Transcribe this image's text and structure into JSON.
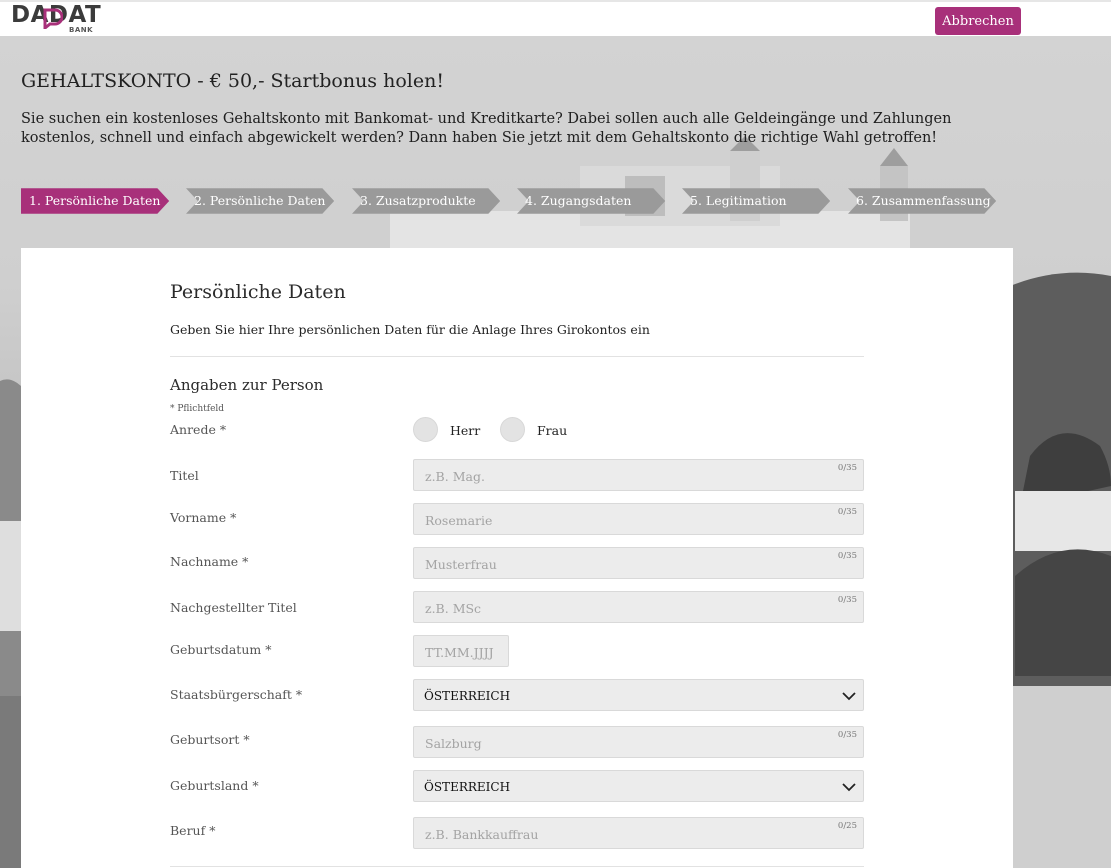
{
  "header": {
    "logo_text": "DADAT",
    "logo_sub": "BANK",
    "cancel_label": "Abbrechen"
  },
  "hero": {
    "title": "GEHALTSKONTO - € 50,- Startbonus holen!",
    "intro": "Sie suchen ein kostenloses Gehaltskonto mit Bankomat- und Kreditkarte? Dabei sollen auch alle Geldeingänge und Zahlungen kostenlos, schnell und einfach abgewickelt werden? Dann haben Sie jetzt mit dem Gehaltskonto die richtige Wahl getroffen!"
  },
  "steps": [
    {
      "label": "1. Persönliche Daten",
      "active": true
    },
    {
      "label": "2. Persönliche Daten",
      "active": false
    },
    {
      "label": "3. Zusatzprodukte",
      "active": false
    },
    {
      "label": "4. Zugangsdaten",
      "active": false
    },
    {
      "label": "5. Legitimation",
      "active": false
    },
    {
      "label": "6. Zusammenfassung",
      "active": false
    }
  ],
  "colors": {
    "accent": "#a8307a",
    "step_inactive": "#9a9a9a"
  },
  "form": {
    "section_title": "Persönliche Daten",
    "section_desc": "Geben Sie hier Ihre persönlichen Daten für die Anlage Ihres Girokontos ein",
    "sub_title": "Angaben zur Person",
    "required_note": "* Pflichtfeld",
    "anrede": {
      "label": "Anrede *",
      "options": [
        "Herr",
        "Frau"
      ]
    },
    "titel": {
      "label": "Titel",
      "placeholder": "z.B. Mag.",
      "counter": "0/35"
    },
    "vorname": {
      "label": "Vorname *",
      "placeholder": "Rosemarie",
      "counter": "0/35"
    },
    "nachname": {
      "label": "Nachname *",
      "placeholder": "Musterfrau",
      "counter": "0/35"
    },
    "nachgestellter_titel": {
      "label": "Nachgestellter Titel",
      "placeholder": "z.B. MSc",
      "counter": "0/35"
    },
    "geburtsdatum": {
      "label": "Geburtsdatum *",
      "placeholder": "TT.MM.JJJJ"
    },
    "staatsbuergerschaft": {
      "label": "Staatsbürgerschaft *",
      "value": "ÖSTERREICH"
    },
    "geburtsort": {
      "label": "Geburtsort *",
      "placeholder": "Salzburg",
      "counter": "0/35"
    },
    "geburtsland": {
      "label": "Geburtsland *",
      "value": "ÖSTERREICH"
    },
    "beruf": {
      "label": "Beruf *",
      "placeholder": "z.B. Bankkauffrau",
      "counter": "0/25"
    }
  }
}
